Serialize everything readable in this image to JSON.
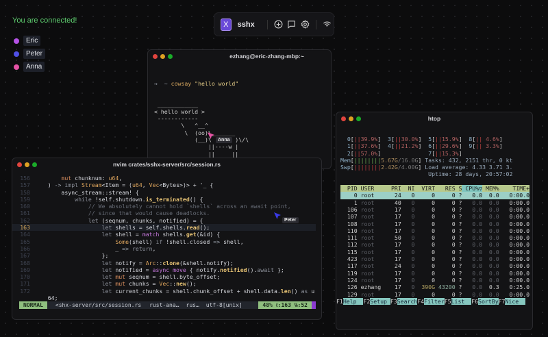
{
  "status_text": "You are connected!",
  "users": [
    {
      "name": "Eric",
      "color": "#b552e6"
    },
    {
      "name": "Peter",
      "color": "#5050e6"
    },
    {
      "name": "Anna",
      "color": "#e452a4"
    }
  ],
  "toolbar": {
    "logo": "X",
    "brand": "sshx",
    "icons": [
      "plus-circle-icon",
      "chat-icon",
      "gear-icon",
      "wifi-icon"
    ]
  },
  "cowsay": {
    "title": "ezhang@eric-zhang-mbp:~",
    "prompt": "→  ~ ",
    "command": "cowsay",
    "arg": "\"hello world\"",
    "art": [
      " ____________",
      "< hello world >",
      " ------------",
      "        \\   ^__^",
      "         \\  (oo)\\_______",
      "            (__)\\       )\\/\\",
      "                ||----w |",
      "                ||     ||"
    ],
    "prompt2": "→  ~"
  },
  "nvim": {
    "title": "nvim crates/sshx-server/src/session.rs",
    "current_line": 163,
    "lines": [
      [
        156,
        [
          [
            "        ",
            ""
          ],
          [
            "mut",
            "m"
          ],
          [
            " chunknum: ",
            ""
          ],
          [
            "u64",
            "t"
          ],
          [
            ",",
            ""
          ]
        ]
      ],
      [
        157,
        [
          [
            "    ) ",
            ""
          ],
          [
            "->",
            "o"
          ],
          [
            " ",
            ""
          ],
          [
            "impl",
            "k"
          ],
          [
            " ",
            ""
          ],
          [
            "Stream",
            "t"
          ],
          [
            "<Item = (",
            ""
          ],
          [
            "u64",
            "t"
          ],
          [
            ", ",
            ""
          ],
          [
            "Vec",
            "t"
          ],
          [
            "<Bytes>)> + '_ {",
            ""
          ]
        ]
      ],
      [
        158,
        [
          [
            "        async_stream::stream! {",
            ""
          ]
        ]
      ],
      [
        159,
        [
          [
            "            ",
            ""
          ],
          [
            "while",
            "k"
          ],
          [
            " !self.shutdown.",
            ""
          ],
          [
            "is_terminated",
            "f"
          ],
          [
            "() {",
            ""
          ]
        ]
      ],
      [
        160,
        [
          [
            "                // We absolutely cannot hold `shells` across an await point,",
            "c"
          ]
        ]
      ],
      [
        161,
        [
          [
            "                // since that would cause deadlocks.",
            "c"
          ]
        ]
      ],
      [
        162,
        [
          [
            "                ",
            ""
          ],
          [
            "let",
            "k"
          ],
          [
            " (seqnum, chunks, notified) = {",
            ""
          ]
        ]
      ],
      [
        163,
        [
          [
            "                    ",
            ""
          ],
          [
            "let",
            "k"
          ],
          [
            " shells = self.shells.",
            ""
          ],
          [
            "read",
            "f"
          ],
          [
            "();",
            ""
          ]
        ]
      ],
      [
        164,
        [
          [
            "                    ",
            ""
          ],
          [
            "let",
            "k"
          ],
          [
            " shell = ",
            ""
          ],
          [
            "match",
            "p"
          ],
          [
            " shells.",
            ""
          ],
          [
            "get",
            "f"
          ],
          [
            "(&id) {",
            ""
          ]
        ]
      ],
      [
        165,
        [
          [
            "                        ",
            ""
          ],
          [
            "Some",
            "t"
          ],
          [
            "(shell) ",
            ""
          ],
          [
            "if",
            "k"
          ],
          [
            " !shell.closed ",
            ""
          ],
          [
            "=>",
            "o"
          ],
          [
            " shell,",
            ""
          ]
        ]
      ],
      [
        166,
        [
          [
            "                        _ ",
            ""
          ],
          [
            "=>",
            "o"
          ],
          [
            " ",
            ""
          ],
          [
            "return",
            "k"
          ],
          [
            ",",
            ""
          ]
        ]
      ],
      [
        167,
        [
          [
            "                    };",
            ""
          ]
        ]
      ],
      [
        168,
        [
          [
            "                    ",
            ""
          ],
          [
            "let",
            "k"
          ],
          [
            " notify = ",
            ""
          ],
          [
            "Arc",
            "t"
          ],
          [
            "::",
            ""
          ],
          [
            "clone",
            "f"
          ],
          [
            "(&shell.notify);",
            ""
          ]
        ]
      ],
      [
        169,
        [
          [
            "                    ",
            ""
          ],
          [
            "let",
            "k"
          ],
          [
            " notified = ",
            ""
          ],
          [
            "async move",
            "p"
          ],
          [
            " { notify.",
            ""
          ],
          [
            "notified",
            "f"
          ],
          [
            "().",
            ""
          ],
          [
            "await",
            "k"
          ],
          [
            " };",
            ""
          ]
        ]
      ],
      [
        170,
        [
          [
            "                    ",
            ""
          ],
          [
            "let",
            "k"
          ],
          [
            " ",
            ""
          ],
          [
            "mut",
            "m"
          ],
          [
            " seqnum = shell.byte_offset;",
            ""
          ]
        ]
      ],
      [
        171,
        [
          [
            "                    ",
            ""
          ],
          [
            "let",
            "k"
          ],
          [
            " ",
            ""
          ],
          [
            "mut",
            "m"
          ],
          [
            " chunks = ",
            ""
          ],
          [
            "Vec",
            "t"
          ],
          [
            "::",
            ""
          ],
          [
            "new",
            "f"
          ],
          [
            "();",
            ""
          ]
        ]
      ],
      [
        172,
        [
          [
            "                    ",
            ""
          ],
          [
            "let",
            "k"
          ],
          [
            " current_chunks = shell.chunk_offset + shell.data.",
            ""
          ],
          [
            "len",
            "f"
          ],
          [
            "() ",
            ""
          ],
          [
            "as",
            "k"
          ],
          [
            " u",
            ""
          ]
        ]
      ],
      [
        "",
        [
          [
            "    64;",
            ""
          ]
        ]
      ]
    ],
    "status": {
      "mode": "NORMAL",
      "file": "<shx-server/src/session.rs",
      "lsp": "rust-ana…",
      "ft": "rus…",
      "enc": "utf-8[unix]",
      "pos": "48% ℓ:163 ℅:52"
    }
  },
  "htop": {
    "title": "htop",
    "cpus": [
      [
        {
          "id": 0,
          "pct": "39.9%"
        },
        {
          "id": 3,
          "pct": "30.0%"
        },
        {
          "id": 5,
          "pct": "15.9%"
        },
        {
          "id": 8,
          "pct": "4.6%"
        }
      ],
      [
        {
          "id": 1,
          "pct": "37.6%"
        },
        {
          "id": 4,
          "pct": "21.2%"
        },
        {
          "id": 6,
          "pct": "29.6%"
        },
        {
          "id": 9,
          "pct": "3.3%"
        }
      ],
      [
        {
          "id": 2,
          "pct": "57.0%"
        },
        null,
        {
          "id": 7,
          "pct": "15.3%"
        },
        null
      ]
    ],
    "mem": {
      "label": "Mem",
      "used": "5.67G",
      "total": "16.0G"
    },
    "swp": {
      "label": "Swp",
      "used": "2.42G",
      "total": "4.00G"
    },
    "tasks": "Tasks: 432, 2151 thr, 0 kt",
    "load": "Load average: 4.33 3.71 3.",
    "uptime": "Uptime: 28 days, 20:57:02",
    "columns": [
      "PID",
      "USER",
      "PRI",
      "NI",
      "VIRT",
      "RES",
      "S",
      "CPU%▽",
      "MEM%",
      "TIME+"
    ],
    "rows": [
      [
        "0",
        "root",
        "24",
        "0",
        "0",
        "0",
        "?",
        "0.0",
        "0.0",
        "0:00.0"
      ],
      [
        "1",
        "root",
        "40",
        "0",
        "0",
        "0",
        "?",
        "0.0",
        "0.0",
        "0:00.0"
      ],
      [
        "106",
        "root",
        "17",
        "0",
        "0",
        "0",
        "?",
        "0.0",
        "0.0",
        "0:00.0"
      ],
      [
        "107",
        "root",
        "17",
        "0",
        "0",
        "0",
        "?",
        "0.0",
        "0.0",
        "0:00.0"
      ],
      [
        "108",
        "root",
        "17",
        "0",
        "0",
        "0",
        "?",
        "0.0",
        "0.0",
        "0:00.0"
      ],
      [
        "110",
        "root",
        "17",
        "0",
        "0",
        "0",
        "?",
        "0.0",
        "0.0",
        "0:00.0"
      ],
      [
        "111",
        "root",
        "50",
        "0",
        "0",
        "0",
        "?",
        "0.0",
        "0.0",
        "0:00.0"
      ],
      [
        "112",
        "root",
        "17",
        "0",
        "0",
        "0",
        "?",
        "0.0",
        "0.0",
        "0:00.0"
      ],
      [
        "115",
        "root",
        "17",
        "0",
        "0",
        "0",
        "?",
        "0.0",
        "0.0",
        "0:00.0"
      ],
      [
        "423",
        "root",
        "17",
        "0",
        "0",
        "0",
        "?",
        "0.0",
        "0.0",
        "0:00.0"
      ],
      [
        "117",
        "root",
        "24",
        "0",
        "0",
        "0",
        "?",
        "0.0",
        "0.0",
        "0:00.0"
      ],
      [
        "119",
        "root",
        "17",
        "0",
        "0",
        "0",
        "?",
        "0.0",
        "0.0",
        "0:00.0"
      ],
      [
        "124",
        "root",
        "17",
        "0",
        "0",
        "0",
        "?",
        "0.0",
        "0.0",
        "0:00.0"
      ],
      [
        "126",
        "ezhang",
        "17",
        "0",
        "390G",
        "43200",
        "?",
        "0.0",
        "0.3",
        "0:25.0"
      ],
      [
        "129",
        "root",
        "17",
        "0",
        "0",
        "0",
        "?",
        "0.0",
        "0.0",
        "0:00.0"
      ]
    ],
    "fkeys": [
      [
        "F1",
        "Help  "
      ],
      [
        "F2",
        "Setup "
      ],
      [
        "F3",
        "Search"
      ],
      [
        "F4",
        "Filter"
      ],
      [
        "F5",
        "List  "
      ],
      [
        "F6",
        "SortBy"
      ],
      [
        "F7",
        "Nice  "
      ]
    ]
  },
  "cursors": [
    {
      "user": "Anna",
      "color": "#e452a4"
    },
    {
      "user": "Peter",
      "color": "#3a3ae6"
    }
  ]
}
